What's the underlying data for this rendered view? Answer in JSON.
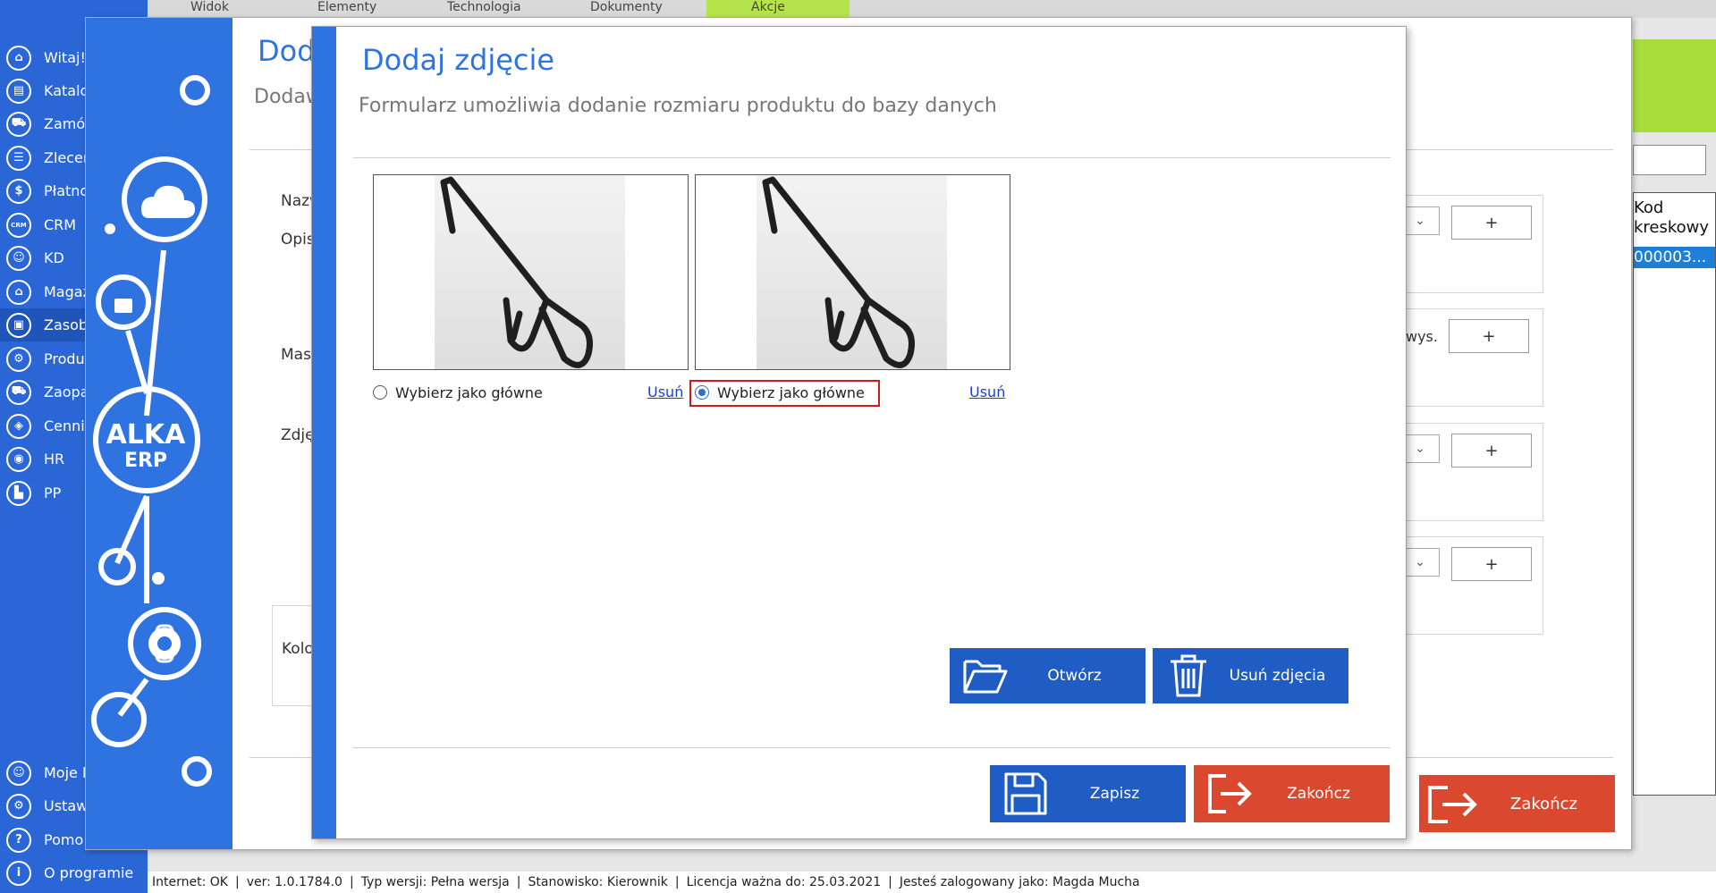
{
  "sidebar": {
    "items": [
      {
        "label": "Witaj!",
        "icon": "home-icon",
        "glyph": "⌂"
      },
      {
        "label": "Katalo",
        "icon": "book-icon",
        "glyph": "▤"
      },
      {
        "label": "Zamó",
        "icon": "cart-icon",
        "glyph": "⛟"
      },
      {
        "label": "Zlecen",
        "icon": "list-icon",
        "glyph": "☰"
      },
      {
        "label": "Płatno",
        "icon": "dollar-icon",
        "glyph": "$"
      },
      {
        "label": "CRM",
        "icon": "crm-icon",
        "glyph": "CRM"
      },
      {
        "label": "KD",
        "icon": "person-icon",
        "glyph": "☺"
      },
      {
        "label": "Magaz",
        "icon": "warehouse-icon",
        "glyph": "⌂"
      },
      {
        "label": "Zasob",
        "icon": "storage-icon",
        "glyph": "▣"
      },
      {
        "label": "Produ",
        "icon": "production-icon",
        "glyph": "⚙"
      },
      {
        "label": "Zaopa",
        "icon": "truck-icon",
        "glyph": "⛟"
      },
      {
        "label": "Cennik",
        "icon": "tag-icon",
        "glyph": "◈"
      },
      {
        "label": "HR",
        "icon": "fingerprint-icon",
        "glyph": "◉"
      },
      {
        "label": "PP",
        "icon": "factory-icon",
        "glyph": "▙"
      }
    ],
    "bottom": [
      {
        "label": "Moje l",
        "icon": "user-icon",
        "glyph": "☺"
      },
      {
        "label": "Ustawi",
        "icon": "settings-icon",
        "glyph": "⚙"
      },
      {
        "label": "Pomo",
        "icon": "help-icon",
        "glyph": "?"
      },
      {
        "label": "O programie",
        "icon": "info-icon",
        "glyph": "i"
      }
    ]
  },
  "top_tabs": [
    "Widok",
    "Elementy",
    "Technologia",
    "Dokumenty",
    "Akcje"
  ],
  "background_window": {
    "title": "Dod",
    "subtitle": "Dodaw",
    "labels": {
      "nazwa": "Nazw",
      "opis": "Opis",
      "masa": "Mas",
      "zdjecia": "Zdję",
      "kolor": "Kolo"
    },
    "wys_label": "wys.",
    "plus": "+",
    "chevron": "⌄",
    "zakoncz": "Zakończ",
    "brand_text_1": "ALKA",
    "brand_text_2": "ERP",
    "grid": {
      "header": "Kod kreskowy",
      "cell": "000003..."
    }
  },
  "modal": {
    "title": "Dodaj zdjęcie",
    "subtitle": "Formularz umożliwia dodanie rozmiaru produktu do bazy danych",
    "photos": [
      {
        "radio_label": "Wybierz jako główne",
        "remove_label": "Usuń",
        "selected": false
      },
      {
        "radio_label": "Wybierz jako główne",
        "remove_label": "Usuń",
        "selected": true
      }
    ],
    "buttons": {
      "open": "Otwórz",
      "delete_photos": "Usuń zdjęcia",
      "save": "Zapisz",
      "close": "Zakończ"
    }
  },
  "status_bar": {
    "internet": "Internet: OK",
    "version": "ver: 1.0.1784.0",
    "type": "Typ wersji: Pełna wersja",
    "station": "Stanowisko: Kierownik",
    "license": "Licencja ważna do: 25.03.2021",
    "user": "Jesteś zalogowany jako: Magda Mucha"
  },
  "colors": {
    "accent": "#2e73e0",
    "sidebar": "#2a66d6",
    "danger": "#d9482f",
    "green": "#a6dd3c",
    "highlight": "#d21a1a"
  }
}
